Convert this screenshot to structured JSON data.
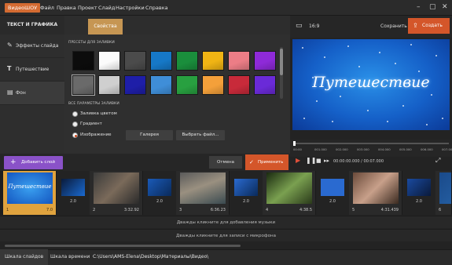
{
  "menubar": {
    "logo": "ВидеоШОУ",
    "items": [
      "Файл",
      "Правка",
      "Проект",
      "Слайд",
      "Настройки",
      "Справка"
    ]
  },
  "left_panel": {
    "header": "ТЕКСТ И ГРАФИКА",
    "items": [
      {
        "label": "Эффекты слайда",
        "icon": "effects-icon"
      },
      {
        "label": "Путешествие",
        "icon": "text-icon"
      },
      {
        "label": "Фон",
        "icon": "background-icon",
        "active": true
      }
    ]
  },
  "properties": {
    "tab": "Свойства",
    "presets_label": "ПРЕСЕТЫ ДЛЯ ЗАЛИВКИ",
    "swatches_row1": [
      "#0c0c0c",
      "#fbfbfb",
      "#4b4b4b",
      "#1678c7",
      "#1a8e3c",
      "#f0b414",
      "#ec7d86",
      "#8e2ad8"
    ],
    "swatches_row2": [
      "#6a6a6a",
      "#cfcfcf",
      "#1e1ea8",
      "#3f8ed8",
      "#28a040",
      "#f4a03a",
      "#c82a3a",
      "#6a2ad8"
    ],
    "all_params_label": "ВСЕ ПАРАМЕТРЫ ЗАЛИВКИ",
    "radio_color": "Заливка цветом",
    "radio_gradient": "Градиент",
    "radio_image": "Изображение",
    "selected": "Изображение",
    "gallery_button": "Галерея",
    "choose_file_button": "Выбрать файл..."
  },
  "preview": {
    "ratio": "16:9",
    "save_label": "Сохранить",
    "create_label": "Создать",
    "title_text": "Путешествие",
    "bg_color": "#1560c8",
    "ticks": [
      "00:00",
      "001.000",
      "002.000",
      "003.000",
      "004.000",
      "005.000",
      "006.000",
      "007.000"
    ],
    "time_display": "00:00:00.000 / 00:07.000",
    "progress": 0.0
  },
  "actions": {
    "add_label": "Добавить слой",
    "cancel_label": "Отмена",
    "apply_label": "Применить"
  },
  "storyboard": {
    "slides": [
      {
        "num": "1",
        "duration": "7.0",
        "selected": true
      },
      {
        "num": "2",
        "duration": "3:32.92"
      },
      {
        "num": "3",
        "duration": "6:36.23"
      },
      {
        "num": "4",
        "duration": "4:38.5"
      },
      {
        "num": "5",
        "duration": "4:31.439"
      },
      {
        "num": "6",
        "duration": ""
      }
    ],
    "transitions": [
      "2.0",
      "2.0",
      "2.0",
      "2.0",
      "2.0",
      "2.0"
    ]
  },
  "audio": {
    "music_hint": "Дважды кликните для добавления музыки",
    "mic_hint": "Дважды кликните для записи с микрофона"
  },
  "status": {
    "tab_slides": "Шкала слайдов",
    "tab_timeline": "Шкала времени",
    "path": "C:\\Users\\AMS-Elena\\Desktop\\Материалы\\Видео\\"
  }
}
